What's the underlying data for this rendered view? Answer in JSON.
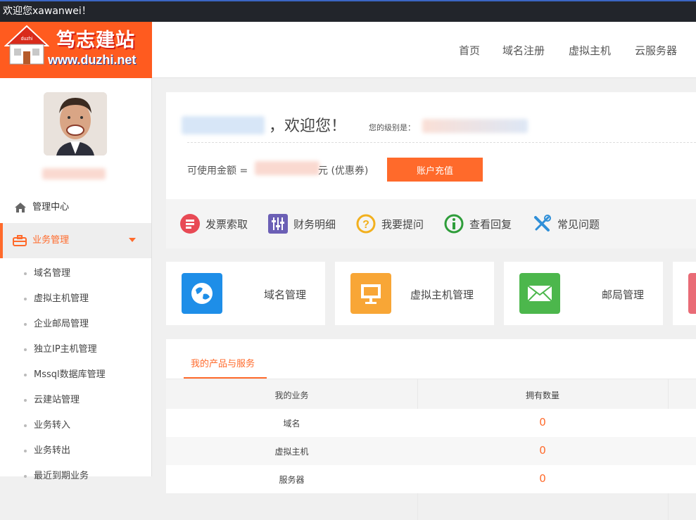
{
  "topbar": {
    "welcome": "欢迎您xawanwei！"
  },
  "brand": {
    "name": "笃志建站",
    "url": "www.duzhi.net"
  },
  "nav": {
    "items": [
      "首页",
      "域名注册",
      "虚拟主机",
      "云服务器"
    ]
  },
  "sidebar": {
    "admin_center": "管理中心",
    "business": "业务管理",
    "sub_items": [
      "域名管理",
      "虚拟主机管理",
      "企业邮局管理",
      "独立IP主机管理",
      "Mssql数据库管理",
      "云建站管理",
      "业务转入",
      "业务转出",
      "最近到期业务"
    ]
  },
  "account": {
    "welcome": "，欢迎您！",
    "level_label": "您的级别是：",
    "balance_label": "可使用金额 =",
    "balance_suffix": "元 (优惠券)",
    "recharge_button": "账户充值"
  },
  "quick": {
    "items": [
      "发票索取",
      "财务明细",
      "我要提问",
      "查看回复",
      "常见问题"
    ]
  },
  "services": {
    "items": [
      "域名管理",
      "虚拟主机管理",
      "邮局管理"
    ]
  },
  "products": {
    "tab": "我的产品与服务",
    "headers": [
      "我的业务",
      "拥有数量"
    ],
    "rows": [
      {
        "name": "域名",
        "count": "0"
      },
      {
        "name": "虚拟主机",
        "count": "0"
      },
      {
        "name": "服务器",
        "count": "0"
      }
    ]
  },
  "colors": {
    "accent": "#ff6a2b",
    "topbar": "#22252b"
  }
}
